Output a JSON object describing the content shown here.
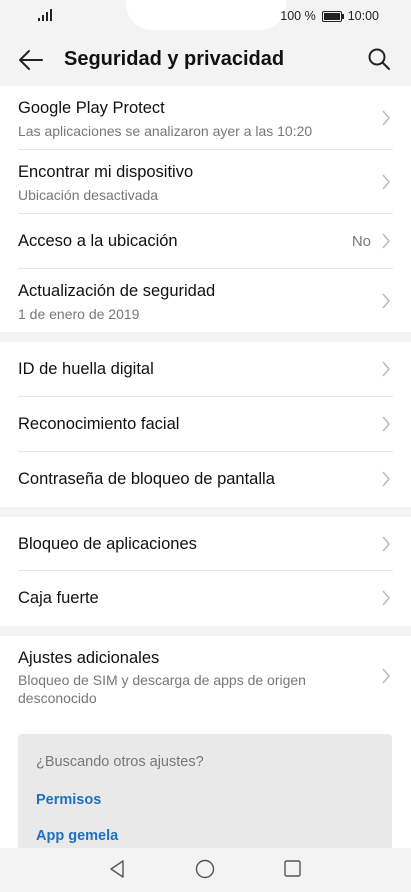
{
  "status_bar": {
    "battery_text": "100 %",
    "time": "10:00"
  },
  "header": {
    "title": "Seguridad y privacidad"
  },
  "icons": {
    "back": "back-arrow-icon",
    "search": "search-icon",
    "chevron": "chevron-right-icon"
  },
  "sections": [
    {
      "items": [
        {
          "title": "Google Play Protect",
          "subtitle": "Las aplicaciones se analizaron ayer a las 10:20"
        },
        {
          "title": "Encontrar mi dispositivo",
          "subtitle": "Ubicación desactivada"
        },
        {
          "title": "Acceso a la ubicación",
          "value": "No"
        },
        {
          "title": "Actualización de seguridad",
          "subtitle": "1 de enero de 2019"
        }
      ]
    },
    {
      "items": [
        {
          "title": "ID de huella digital"
        },
        {
          "title": "Reconocimiento facial"
        },
        {
          "title": "Contraseña de bloqueo de pantalla"
        }
      ]
    },
    {
      "items": [
        {
          "title": "Bloqueo de aplicaciones"
        },
        {
          "title": "Caja fuerte"
        }
      ]
    },
    {
      "items": [
        {
          "title": "Ajustes adicionales",
          "subtitle": "Bloqueo de SIM y descarga de apps de origen desconocido"
        }
      ]
    }
  ],
  "suggestions": {
    "question": "¿Buscando otros ajustes?",
    "links": [
      "Permisos",
      "App gemela"
    ]
  },
  "colors": {
    "accent": "#1e6fc2",
    "background": "#f3f3f3"
  }
}
